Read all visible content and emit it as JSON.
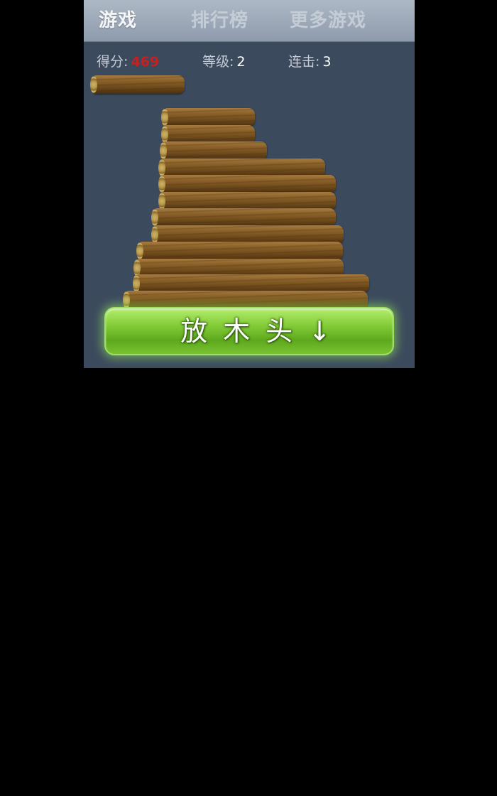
{
  "tabs": {
    "game": "游戏",
    "rank": "排行榜",
    "more": "更多游戏"
  },
  "stats": {
    "score_label": "得分:",
    "score_value": "469",
    "level_label": "等级:",
    "level_value": "2",
    "combo_label": "连击:",
    "combo_value": "3"
  },
  "drop_button": {
    "label": "放木头↓"
  },
  "colors": {
    "frame_bg": "#3c4a5e",
    "score": "#c62020",
    "button_green": "#86cf3a"
  }
}
